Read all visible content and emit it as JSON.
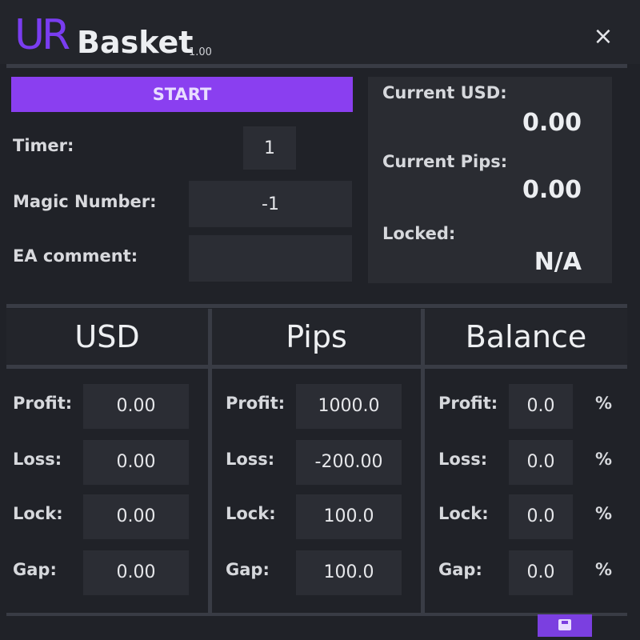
{
  "header": {
    "logo_ur": "UR",
    "logo_name": "Basket",
    "version": "1.00",
    "close_icon": "×"
  },
  "controls": {
    "start_label": "START",
    "timer_label": "Timer:",
    "timer_value": "1",
    "magic_label": "Magic Number:",
    "magic_value": "-1",
    "comment_label": "EA comment:",
    "comment_value": ""
  },
  "status": {
    "usd_label": "Current USD:",
    "usd_value": "0.00",
    "pips_label": "Current Pips:",
    "pips_value": "0.00",
    "locked_label": "Locked:",
    "locked_value": "N/A"
  },
  "usd": {
    "title": "USD",
    "profit_label": "Profit:",
    "profit": "0.00",
    "loss_label": "Loss:",
    "loss": "0.00",
    "lock_label": "Lock:",
    "lock": "0.00",
    "gap_label": "Gap:",
    "gap": "0.00"
  },
  "pips": {
    "title": "Pips",
    "profit_label": "Profit:",
    "profit": "1000.0",
    "loss_label": "Loss:",
    "loss": "-200.00",
    "lock_label": "Lock:",
    "lock": "100.0",
    "gap_label": "Gap:",
    "gap": "100.0"
  },
  "balance": {
    "title": "Balance",
    "profit_label": "Profit:",
    "profit": "0.0",
    "loss_label": "Loss:",
    "loss": "0.0",
    "lock_label": "Lock:",
    "lock": "0.0",
    "gap_label": "Gap:",
    "gap": "0.0",
    "percent": "%"
  },
  "colors": {
    "accent": "#8a3ff0",
    "background": "#202228",
    "input": "#2b2d34"
  },
  "icons": {
    "close": "close-icon",
    "save": "save-icon"
  }
}
